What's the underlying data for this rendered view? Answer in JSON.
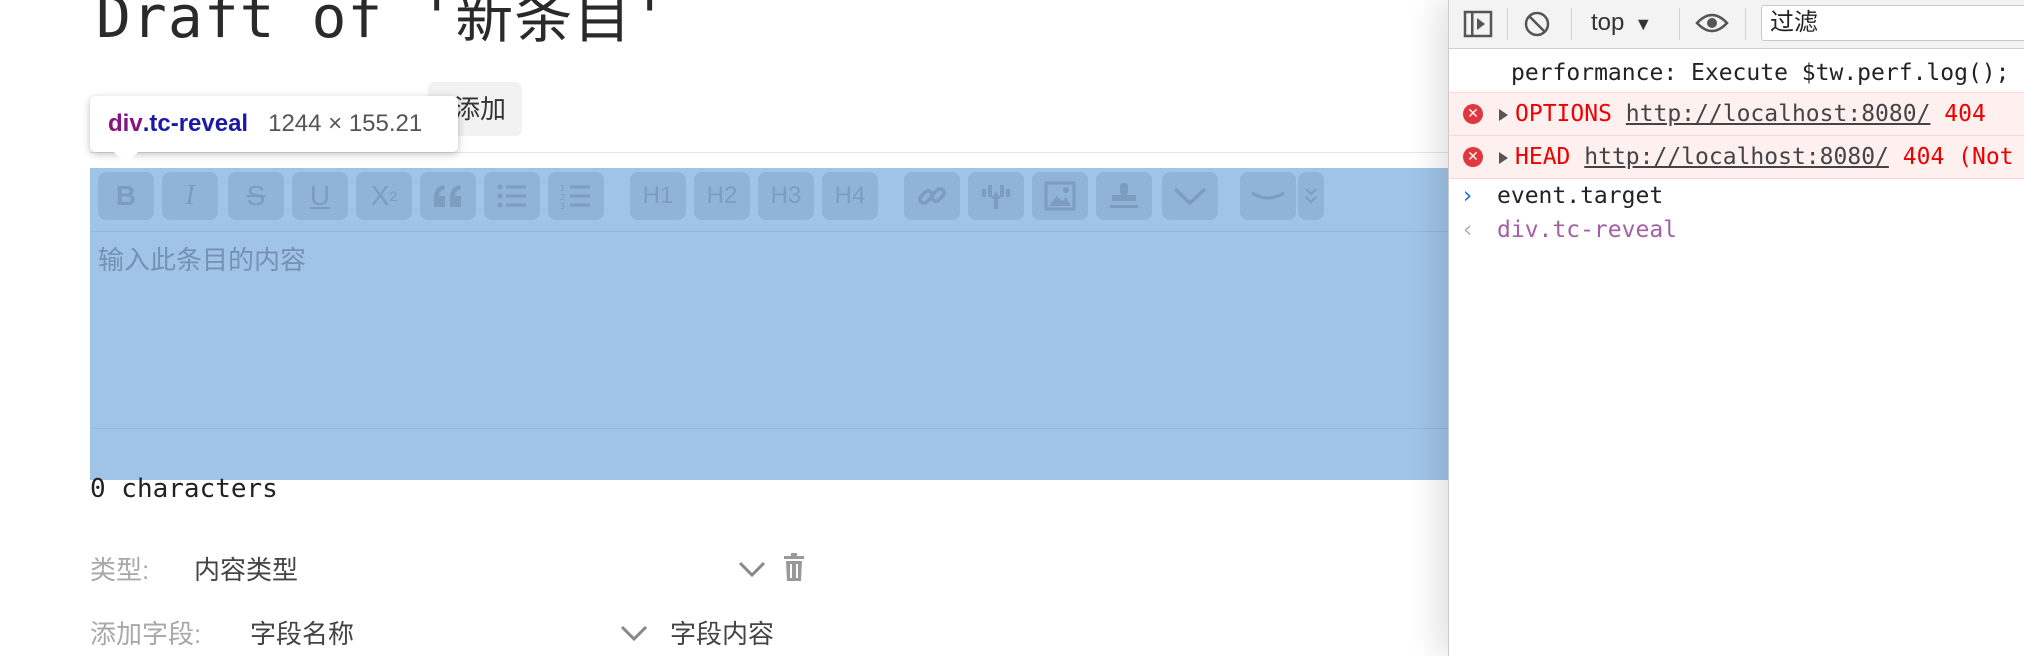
{
  "page": {
    "title": "Draft of '新条目'",
    "add_button": "添加",
    "editor_placeholder": "输入此条目的内容",
    "char_count": "0 characters",
    "type_label": "类型:",
    "type_placeholder": "内容类型",
    "add_field_label": "添加字段:",
    "field_name_placeholder": "字段名称",
    "field_value_placeholder": "字段内容"
  },
  "toolbar": {
    "bold": "B",
    "italic": "I",
    "strike": "S",
    "underline": "U",
    "superscript": "X",
    "superscript_mark": "2",
    "h1": "H1",
    "h2": "H2",
    "h3": "H3",
    "h4": "H4",
    "icons": [
      "quote-icon",
      "bullet-list-icon",
      "numbered-list-icon",
      "link-icon",
      "transclude-icon",
      "image-icon",
      "stamp-icon",
      "chevron-down-icon",
      "preview-icon",
      "more-icon"
    ]
  },
  "inspector_tooltip": {
    "tag": "div",
    "class": ".tc-reveal",
    "dims": "1244 × 155.21"
  },
  "devtools": {
    "context": "top",
    "filter_placeholder": "过滤",
    "logs": {
      "perf": "performance: Execute $tw.perf.log();",
      "error1_method": "OPTIONS",
      "error1_url": "http://localhost:8080/",
      "error1_status": "404",
      "error2_method": "HEAD",
      "error2_url": "http://localhost:8080/",
      "error2_status": "404 (Not",
      "input": "event.target",
      "result": "div.tc-reveal"
    }
  },
  "colors": {
    "highlight_overlay": "#a0c4e8",
    "error_text": "#ee0000",
    "error_bg": "#fff0f0"
  }
}
